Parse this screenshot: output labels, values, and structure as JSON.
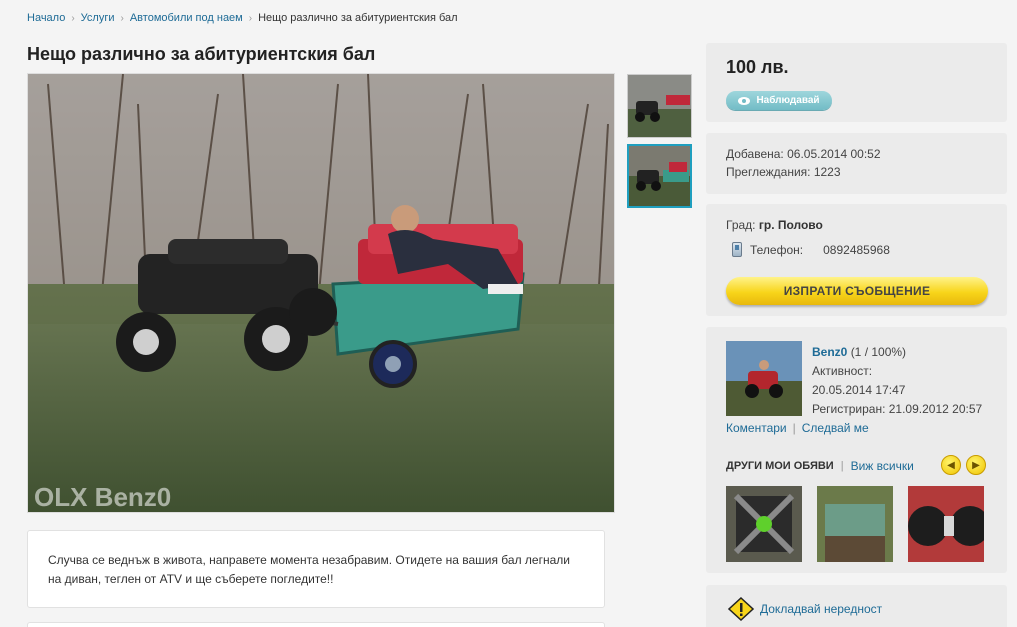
{
  "breadcrumb": {
    "items": [
      "Начало",
      "Услуги",
      "Автомобили под наем"
    ],
    "current": "Нещо различно за абитуриентския бал"
  },
  "ad": {
    "title": "Нещо различно за абитуриентския бал",
    "watermark": "OLX Benz0",
    "description_line1": "Случва се веднъж в живота, направете момента незабравим. Отидете на вашия бал легнали",
    "description_line2": "на диван, теглен от ATV и ще съберете погледите!!"
  },
  "price": {
    "value": "100 лв.",
    "watch_label": "Наблюдавай"
  },
  "meta": {
    "added": "Добавена: 06.05.2014 00:52",
    "views": "Преглеждания: 1223"
  },
  "contact": {
    "city_label": "Град:",
    "city_value": "гр. Полово",
    "phone_label": "Телефон:",
    "phone_value": "0892485968",
    "send_label": "ИЗПРАТИ СЪОБЩЕНИЕ"
  },
  "user": {
    "name": "Benz0",
    "rating": "(1 / 100%)",
    "activity_label": "Активност:",
    "activity_value": "20.05.2014 17:47",
    "registered": "Регистриран: 21.09.2012 20:57",
    "comments_link": "Коментари",
    "follow_link": "Следвай ме",
    "other_ads_label": "ДРУГИ МОИ ОБЯВИ",
    "view_all_link": "Виж всички"
  },
  "report": {
    "label": "Докладвай нередност"
  },
  "colors": {
    "link": "#1e6b96",
    "accent": "#1f9fbf",
    "button_yellow": "#f8d51a",
    "panel_bg": "#ebebeb"
  }
}
